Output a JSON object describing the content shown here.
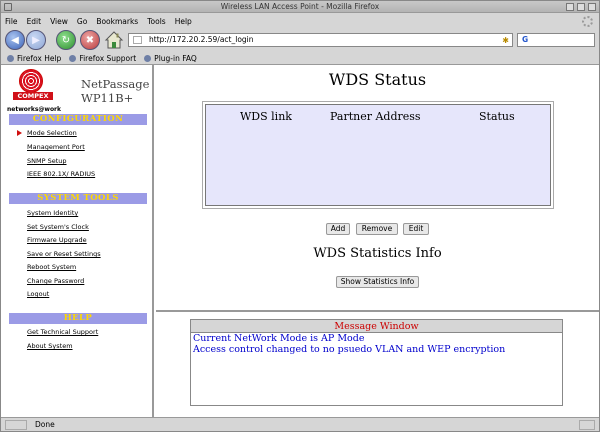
{
  "window": {
    "title": "Wireless LAN Access Point - Mozilla Firefox"
  },
  "menu": [
    "File",
    "Edit",
    "View",
    "Go",
    "Bookmarks",
    "Tools",
    "Help"
  ],
  "address": {
    "url": "http://172.20.2.59/act_login"
  },
  "search": {
    "engine_letter": "G"
  },
  "bookmarks": [
    "Firefox Help",
    "Firefox Support",
    "Plug-in FAQ"
  ],
  "brand": {
    "logo_text": "COMPEX",
    "tagline": "networks@work",
    "product_line1": "NetPassage",
    "product_line2": "WP11B+"
  },
  "sidebar": {
    "configuration": {
      "heading": "CONFIGURATION",
      "items": [
        "Mode Selection",
        "Management Port",
        "SNMP Setup",
        "IEEE 802.1X/ RADIUS"
      ]
    },
    "system_tools": {
      "heading": "SYSTEM TOOLS",
      "items": [
        "System Identity",
        "Set System's Clock",
        "Firmware Upgrade",
        "Save or Reset Settings",
        "Reboot System",
        "Change Password",
        "Logout"
      ]
    },
    "help": {
      "heading": "HELP",
      "items": [
        "Get Technical Support",
        "About System"
      ]
    }
  },
  "main": {
    "title": "WDS Status",
    "columns": [
      "WDS link",
      "Partner Address",
      "Status"
    ],
    "buttons": {
      "add": "Add",
      "remove": "Remove",
      "edit": "Edit"
    },
    "stats_title": "WDS Statistics Info",
    "stats_button": "Show Statistics Info"
  },
  "messages": {
    "title": "Message Window",
    "lines": [
      "Current NetWork Mode is AP Mode",
      "Access control changed to no psuedo VLAN and WEP encryption"
    ]
  },
  "status": {
    "text": "Done"
  },
  "colors": {
    "section_bg": "#9b9be6",
    "section_text": "#ffd800",
    "table_bg": "#e6e6fb",
    "message_text": "#0000cc",
    "message_title": "#cc0000"
  }
}
